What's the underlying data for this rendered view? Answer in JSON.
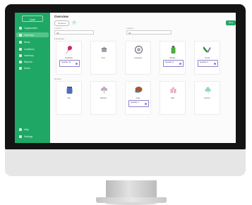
{
  "sidebar": {
    "logo": "Cpm",
    "items": [
      {
        "label": "Organization",
        "active": false,
        "icon": "building-icon"
      },
      {
        "label": "Overview",
        "active": true,
        "icon": "grid-icon"
      },
      {
        "label": "Items",
        "active": false,
        "icon": "box-icon"
      },
      {
        "label": "Locations",
        "active": false,
        "icon": "pin-icon"
      },
      {
        "label": "Inventory",
        "active": false,
        "icon": "list-icon"
      },
      {
        "label": "Reports",
        "active": false,
        "icon": "chart-icon"
      },
      {
        "label": "Alerts",
        "active": false,
        "icon": "bell-icon"
      }
    ],
    "bottom_items": [
      {
        "label": "Help",
        "icon": "help-icon"
      },
      {
        "label": "Settings",
        "icon": "gear-icon"
      }
    ]
  },
  "main": {
    "title": "Overview",
    "filter_pill": "All items",
    "filter_badge": "+",
    "primary_button": "Save",
    "secondary_button": "...",
    "fields": [
      {
        "label": "Location",
        "value": "All"
      },
      {
        "label": "Category",
        "value": "All"
      }
    ],
    "section1_label": "Favourites",
    "section2_label": "Recent",
    "cards_row1": [
      {
        "label": "Pushpin",
        "icon": "pushpin-icon",
        "color": "#d7226a",
        "stepper": "Quantity 12",
        "foot": ""
      },
      {
        "label": "Pot",
        "icon": "pot-icon",
        "color": "#8a8f97",
        "stepper": "",
        "foot": ""
      },
      {
        "label": "Camera",
        "icon": "camera-lens-icon",
        "color": "#6b7380",
        "stepper": "",
        "foot": ""
      },
      {
        "label": "Bottle",
        "icon": "bottle-icon",
        "color": "#4cae3b",
        "stepper": "Quantity 6",
        "foot": ""
      },
      {
        "label": "Tools",
        "icon": "tools-icon",
        "color": "#2e8a3a",
        "stepper": "Quantity 3",
        "foot": ""
      }
    ],
    "cards_row2": [
      {
        "label": "Jar",
        "icon": "jar-icon",
        "color": "#4f6fb8",
        "stepper": "",
        "foot": ""
      },
      {
        "label": "Flower",
        "icon": "flower-icon",
        "color": "#c9a0c8",
        "stepper": "",
        "foot": ""
      },
      {
        "label": "Cap",
        "icon": "cap-icon",
        "color": "#b0542b",
        "stepper": "Quantity 1",
        "foot": ""
      },
      {
        "label": "Gift",
        "icon": "gift-icon",
        "color": "#e38ab0",
        "stepper": "",
        "foot": ""
      },
      {
        "label": "Clover",
        "icon": "clover-icon",
        "color": "#8fd7b8",
        "stepper": "",
        "foot": ""
      }
    ]
  }
}
